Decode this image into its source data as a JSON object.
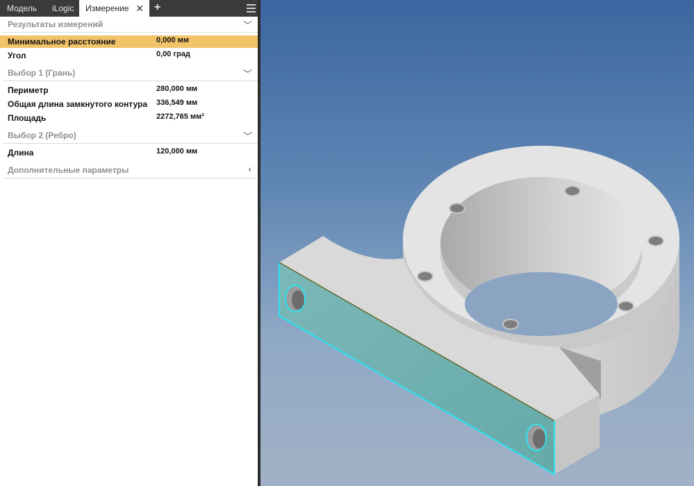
{
  "tabs": {
    "model": "Модель",
    "ilogic": "iLogic",
    "measure": "Измерение",
    "add": "+"
  },
  "sections": {
    "results": "Результаты измерений",
    "selection1": "Выбор 1 (Грань)",
    "selection2": "Выбор 2 (Ребро)",
    "additional": "Дополнительные параметры"
  },
  "results": [
    {
      "name": "Минимальное расстояние",
      "value": "0,000 мм"
    },
    {
      "name": "Угол",
      "value": "0,00 град"
    }
  ],
  "selection1": [
    {
      "name": "Периметр",
      "value": "280,000 мм"
    },
    {
      "name": "Общая длина замкнутого контура",
      "value": "336,549 мм"
    },
    {
      "name": "Площадь",
      "value": "2272,765 мм²"
    }
  ],
  "selection2": [
    {
      "name": "Длина",
      "value": "120,000 мм"
    }
  ],
  "colors": {
    "highlight": "#f2c46a",
    "selected_face": "#6bb0b0",
    "selected_edge": "#29e3f2",
    "part_body": "#cfcfcf"
  },
  "icons": {
    "close": "close-icon",
    "expand": "chevron-down-icon",
    "collapsed": "chevron-left-icon",
    "menu": "hamburger-menu-icon"
  }
}
